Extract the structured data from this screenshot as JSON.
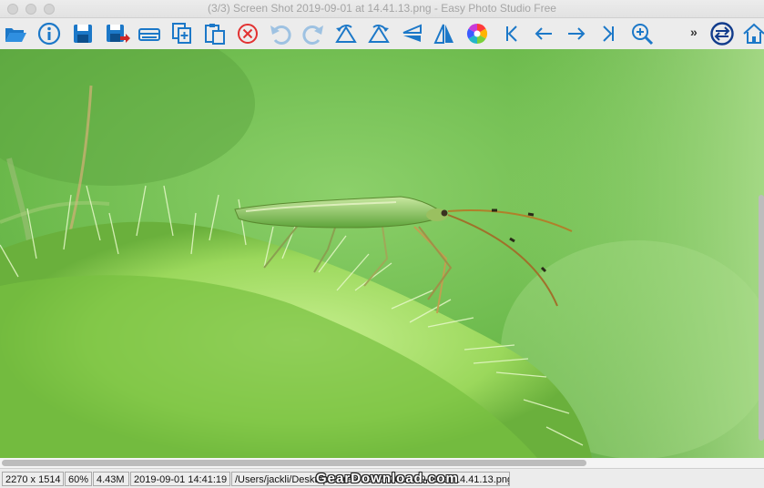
{
  "window": {
    "title": "(3/3) Screen Shot 2019-09-01 at 14.41.13.png - Easy Photo Studio Free"
  },
  "toolbar": {
    "overflow_label": "»",
    "buttons": [
      {
        "name": "open-folder-icon",
        "color": "#1c78c8"
      },
      {
        "name": "info-icon",
        "color": "#1c78c8"
      },
      {
        "name": "save-icon",
        "color": "#1c78c8"
      },
      {
        "name": "save-as-icon",
        "color": "#1c78c8"
      },
      {
        "name": "scanner-icon",
        "color": "#1c78c8"
      },
      {
        "name": "copy-icon",
        "color": "#1c78c8"
      },
      {
        "name": "paste-icon",
        "color": "#1c78c8"
      },
      {
        "name": "delete-icon",
        "color": "#e23232"
      },
      {
        "name": "undo-icon",
        "color": "#9ec2e2"
      },
      {
        "name": "redo-icon",
        "color": "#9ec2e2"
      },
      {
        "name": "rotate-left-icon",
        "color": "#1c78c8"
      },
      {
        "name": "rotate-right-icon",
        "color": "#1c78c8"
      },
      {
        "name": "flip-vertical-icon",
        "color": "#1c78c8"
      },
      {
        "name": "flip-horizontal-icon",
        "color": "#1c78c8"
      },
      {
        "name": "color-wheel-icon",
        "color": "#e0407a"
      },
      {
        "name": "first-image-icon",
        "color": "#1c78c8"
      },
      {
        "name": "previous-image-icon",
        "color": "#1c78c8"
      },
      {
        "name": "next-image-icon",
        "color": "#1c78c8"
      },
      {
        "name": "last-image-icon",
        "color": "#1c78c8"
      },
      {
        "name": "zoom-in-icon",
        "color": "#1c78c8"
      },
      {
        "name": "swap-icon",
        "color": "#123c8c"
      },
      {
        "name": "home-icon",
        "color": "#1c78c8"
      }
    ]
  },
  "statusbar": {
    "dimensions": "2270 x 1514",
    "zoom": "60%",
    "file_size": "4.43M",
    "datetime": "2019-09-01 14:41:19",
    "path": "/Users/jackli/Desktop/Screen Shot 2019-09-01 at 14.41.13.png"
  },
  "watermark": {
    "text": "GearDownload.com"
  }
}
